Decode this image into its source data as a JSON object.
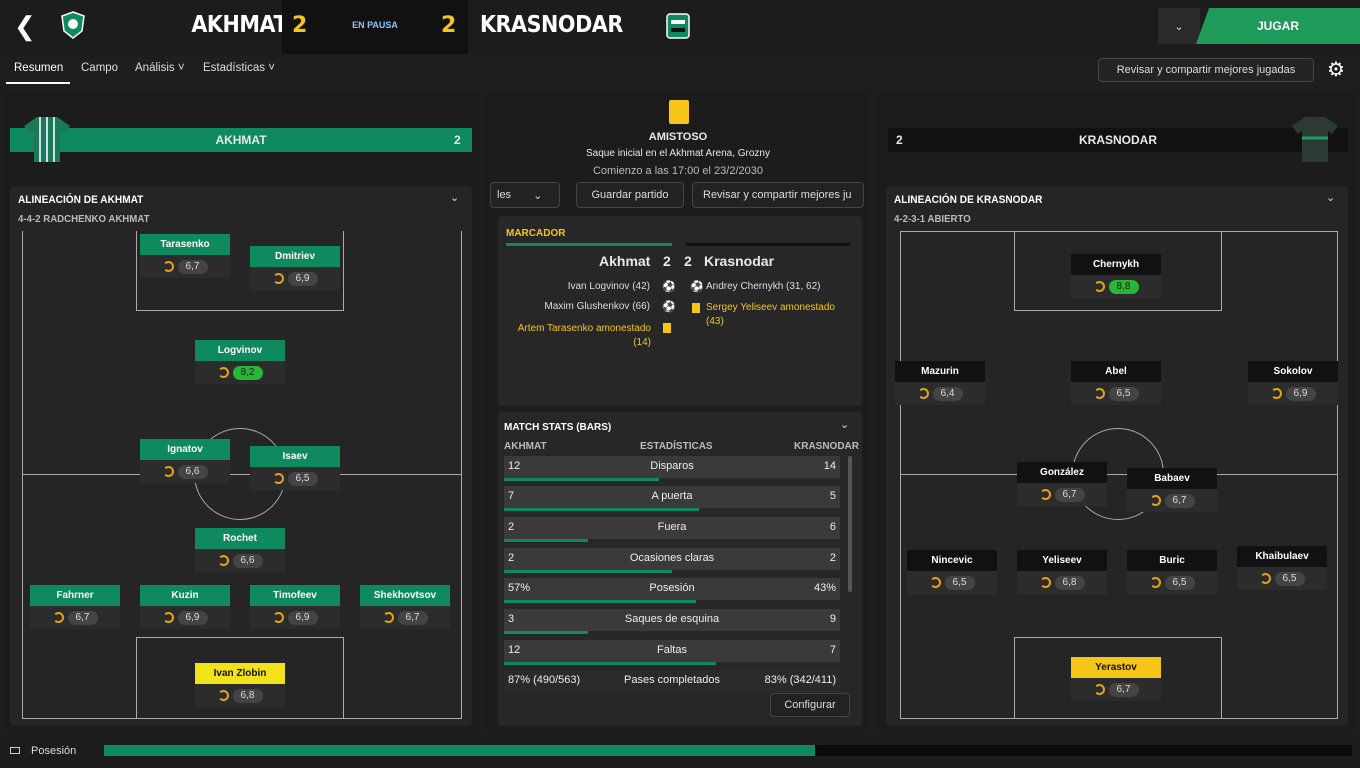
{
  "header": {
    "home": "AKHMAT",
    "away": "KRASNODAR",
    "home_score": "2",
    "away_score": "2",
    "status": "EN PAUSA",
    "play": "JUGAR",
    "back": "<"
  },
  "tabs": [
    "Resumen",
    "Campo",
    "Análisis",
    "Estadísticas"
  ],
  "share_top": "Revisar y compartir mejores jugadas",
  "match": {
    "comp": "AMISTOSO",
    "venue": "Saque inicial en el Akhmat Arena, Grozny",
    "start": "Comienzo a las 17:00 el 23/2/2030"
  },
  "mid_buttons": {
    "cut": "les",
    "save": "Guardar partido",
    "share": "Revisar y compartir mejores ju"
  },
  "scoreboard": {
    "title": "MARCADOR",
    "home": "Akhmat",
    "away": "Krasnodar",
    "hs": "2",
    "as": "2",
    "home_events": [
      {
        "text": "Ivan Logvinov (42)",
        "type": "goal"
      },
      {
        "text": "Maxim Glushenkov (66)",
        "type": "goal"
      },
      {
        "text": "Artem Tarasenko amonestado (14)",
        "type": "card"
      }
    ],
    "away_events": [
      {
        "text": "Andrey Chernykh (31, 62)",
        "type": "goal"
      },
      {
        "text": "Sergey Yeliseev amonestado (43)",
        "type": "card"
      }
    ]
  },
  "stats": {
    "title": "MATCH STATS (BARS)",
    "h_home": "AKHMAT",
    "h_mid": "ESTADÍSTICAS",
    "h_away": "KRASNODAR",
    "config": "Configurar",
    "rows": [
      {
        "l": "12",
        "c": "Disparos",
        "r": "14",
        "f": 0.46
      },
      {
        "l": "7",
        "c": "A puerta",
        "r": "5",
        "f": 0.58
      },
      {
        "l": "2",
        "c": "Fuera",
        "r": "6",
        "f": 0.25
      },
      {
        "l": "2",
        "c": "Ocasiones claras",
        "r": "2",
        "f": 0.5
      },
      {
        "l": "57%",
        "c": "Posesión",
        "r": "43%",
        "f": 0.57
      },
      {
        "l": "3",
        "c": "Saques de esquina",
        "r": "9",
        "f": 0.25
      },
      {
        "l": "12",
        "c": "Faltas",
        "r": "7",
        "f": 0.63
      },
      {
        "l": "87% (490/563)",
        "c": "Pases completados",
        "r": "83% (342/411)",
        "f": 0
      }
    ]
  },
  "home": {
    "banner": "AKHMAT",
    "score": "2",
    "lineup": "ALINEACIÓN DE AKHMAT",
    "formation": "4-4-2 RADCHENKO AKHMAT",
    "players": [
      {
        "n": "Tarasenko",
        "r": "6,7"
      },
      {
        "n": "Dmitriev",
        "r": "6,9"
      },
      {
        "n": "Logvinov",
        "r": "8,2",
        "hi": true
      },
      {
        "n": "Ignatov",
        "r": "6,6"
      },
      {
        "n": "Isaev",
        "r": "6,5"
      },
      {
        "n": "Rochet",
        "r": "6,6"
      },
      {
        "n": "Fahrner",
        "r": "6,7"
      },
      {
        "n": "Kuzin",
        "r": "6,9"
      },
      {
        "n": "Timofeev",
        "r": "6,9"
      },
      {
        "n": "Shekhovtsov",
        "r": "6,7"
      },
      {
        "n": "Ivan Zlobin",
        "r": "6,8",
        "gk": true
      }
    ]
  },
  "away": {
    "banner": "KRASNODAR",
    "score": "2",
    "lineup": "ALINEACIÓN DE KRASNODAR",
    "formation": "4-2-3-1 ABIERTO",
    "players": [
      {
        "n": "Chernykh",
        "r": "8,8",
        "hi": true
      },
      {
        "n": "Mazurin",
        "r": "6,4"
      },
      {
        "n": "Abel",
        "r": "6,5"
      },
      {
        "n": "Sokolov",
        "r": "6,9"
      },
      {
        "n": "González",
        "r": "6,7"
      },
      {
        "n": "Babaev",
        "r": "6,7"
      },
      {
        "n": "Nincevic",
        "r": "6,5"
      },
      {
        "n": "Yeliseev",
        "r": "6,8"
      },
      {
        "n": "Buric",
        "r": "6,5"
      },
      {
        "n": "Khaibulaev",
        "r": "6,5"
      },
      {
        "n": "Yerastov",
        "r": "6,7",
        "gk": true
      }
    ]
  },
  "possession": {
    "label": "Posesión",
    "home": 0.57
  },
  "colors": {
    "green": "#0f8a5f",
    "yellow": "#f5c518",
    "play": "#1f9a5a"
  }
}
